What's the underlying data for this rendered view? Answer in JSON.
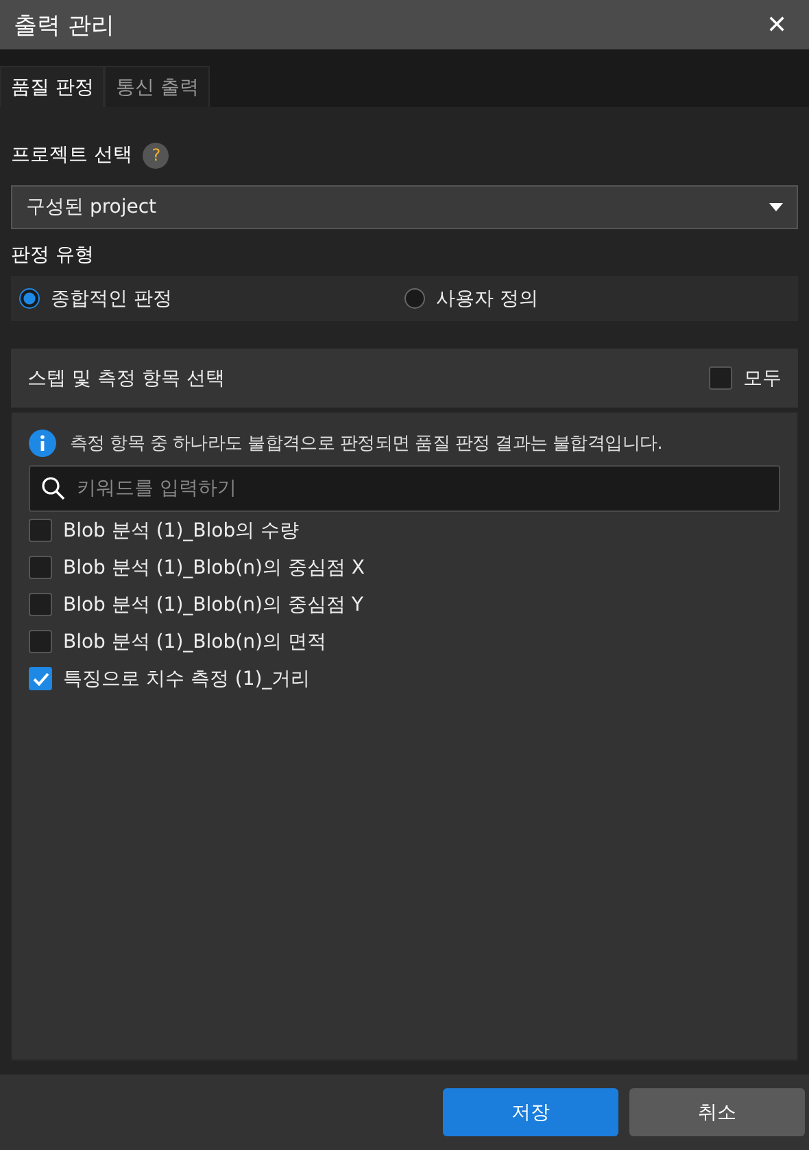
{
  "window": {
    "title": "출력 관리",
    "close": "✕"
  },
  "tabs": [
    {
      "label": "품질 판정",
      "selected": true
    },
    {
      "label": "통신 출력",
      "selected": false
    }
  ],
  "project": {
    "label": "프로젝트 선택",
    "help": "?",
    "value": "구성된 project"
  },
  "judgement": {
    "label": "판정 유형",
    "options": [
      {
        "label": "종합적인 판정",
        "selected": true
      },
      {
        "label": "사용자 정의",
        "selected": false
      }
    ]
  },
  "section": {
    "title": "스텝 및 측정 항목 선택",
    "all": {
      "label": "모두",
      "checked": false
    }
  },
  "info": "측정 항목 중 하나라도 불합격으로 판정되면 품질 판정 결과는 불합격입니다.",
  "search": {
    "placeholder": "키워드를 입력하기"
  },
  "items": [
    {
      "label": "Blob 분석 (1)_Blob의 수량",
      "checked": false
    },
    {
      "label": "Blob 분석 (1)_Blob(n)의 중심점 X",
      "checked": false
    },
    {
      "label": "Blob 분석 (1)_Blob(n)의 중심점 Y",
      "checked": false
    },
    {
      "label": "Blob 분석 (1)_Blob(n)의 면적",
      "checked": false
    },
    {
      "label": "특징으로 치수 측정 (1)_거리",
      "checked": true
    }
  ],
  "buttons": [
    {
      "label": "저장",
      "kind": "primary"
    },
    {
      "label": "취소",
      "kind": "secondary"
    }
  ]
}
